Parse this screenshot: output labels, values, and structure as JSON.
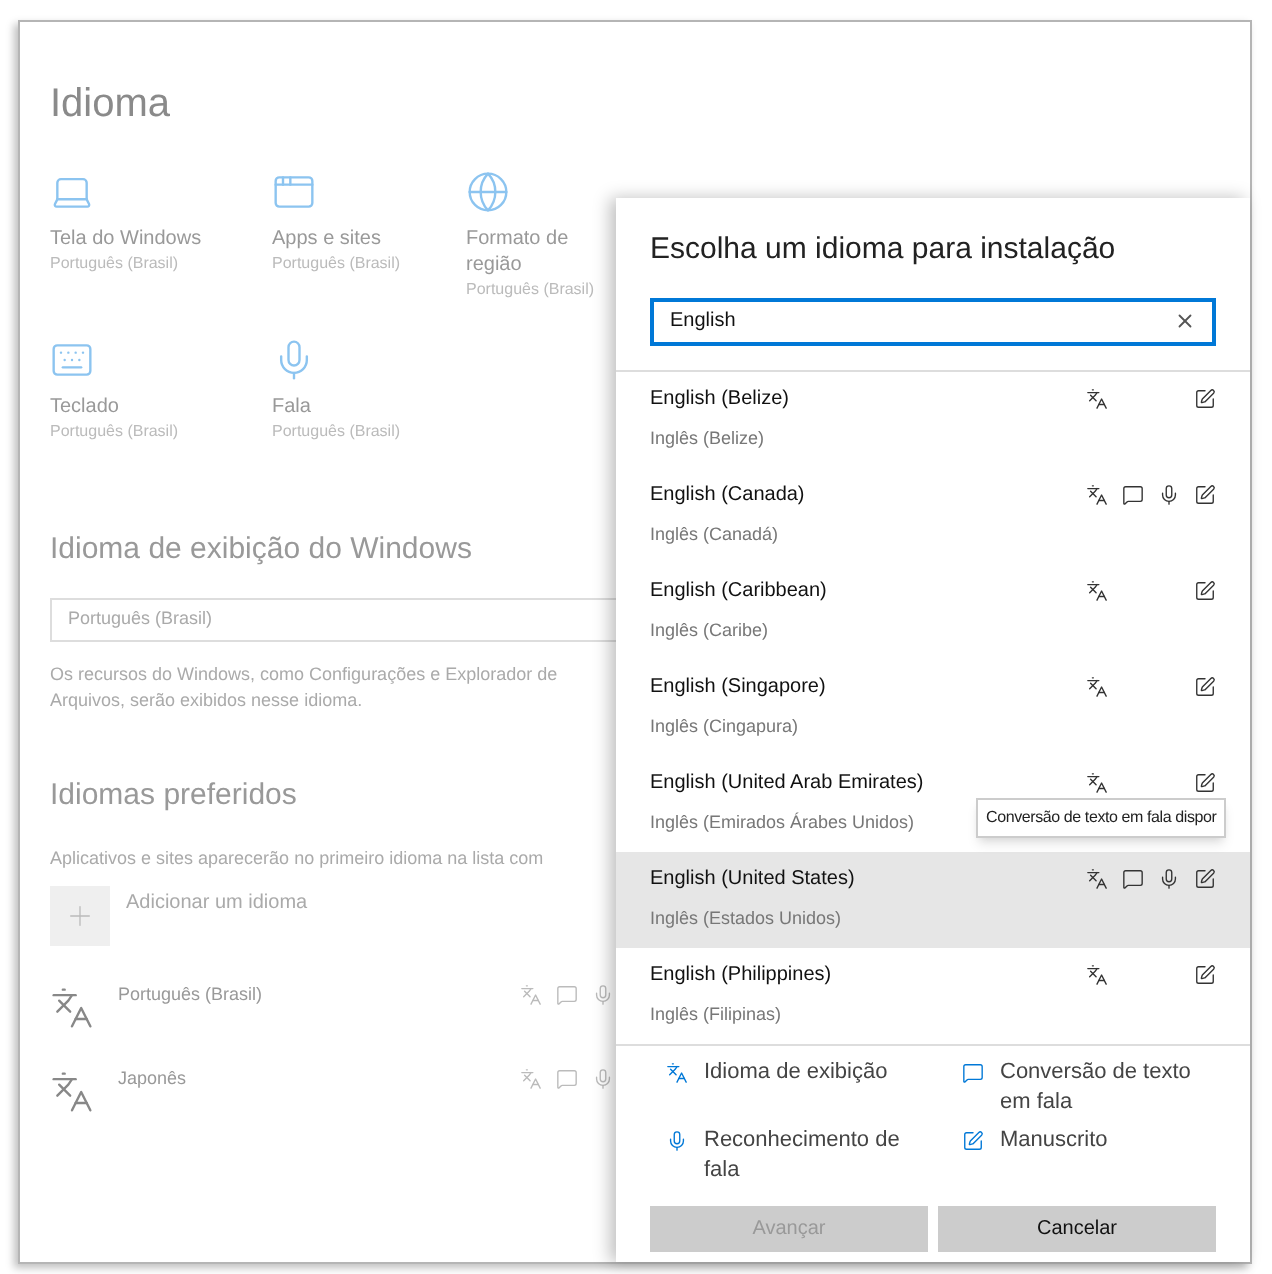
{
  "settings": {
    "title": "Idioma",
    "tiles": [
      {
        "kind": "laptop",
        "label": "Tela do Windows",
        "value": "Português (Brasil)"
      },
      {
        "kind": "window",
        "label": "Apps e sites",
        "value": "Português (Brasil)"
      },
      {
        "kind": "globe",
        "label": "Formato de região",
        "value": "Português (Brasil)"
      },
      {
        "kind": "keyboard",
        "label": "Teclado",
        "value": "Português (Brasil)"
      },
      {
        "kind": "microphone",
        "label": "Fala",
        "value": "Português (Brasil)"
      }
    ],
    "display_language": {
      "heading": "Idioma de exibição do Windows",
      "dropdown": "Português (Brasil)",
      "description": "Os recursos do Windows, como Configurações e Explorador de Arquivos, serão exibidos nesse idioma."
    },
    "preferred": {
      "heading": "Idiomas preferidos",
      "description": "Aplicativos e sites aparecerão no primeiro idioma na lista com",
      "add_label": "Adicionar um idioma",
      "languages": [
        {
          "name": "Português (Brasil)",
          "display": true,
          "tts": true,
          "speech": true
        },
        {
          "name": "Japonês",
          "display": true,
          "tts": true,
          "speech": true
        }
      ]
    }
  },
  "dialog": {
    "title": "Escolha um idioma para instalação",
    "search": {
      "value": "English"
    },
    "languages": [
      {
        "name": "English (Belize)",
        "native": "Inglês (Belize)",
        "display": true,
        "tts": false,
        "speech": false,
        "handwriting": true,
        "selected": false
      },
      {
        "name": "English (Canada)",
        "native": "Inglês (Canadá)",
        "display": true,
        "tts": true,
        "speech": true,
        "handwriting": true,
        "selected": false
      },
      {
        "name": "English (Caribbean)",
        "native": "Inglês (Caribe)",
        "display": true,
        "tts": false,
        "speech": false,
        "handwriting": true,
        "selected": false
      },
      {
        "name": "English (Singapore)",
        "native": "Inglês (Cingapura)",
        "display": true,
        "tts": false,
        "speech": false,
        "handwriting": true,
        "selected": false
      },
      {
        "name": "English (United Arab Emirates)",
        "native": "Inglês (Emirados Árabes Unidos)",
        "display": true,
        "tts": false,
        "speech": false,
        "handwriting": true,
        "selected": false
      },
      {
        "name": "English (United States)",
        "native": "Inglês (Estados Unidos)",
        "display": true,
        "tts": true,
        "speech": true,
        "handwriting": true,
        "selected": true
      },
      {
        "name": "English (Philippines)",
        "native": "Inglês (Filipinas)",
        "display": true,
        "tts": false,
        "speech": false,
        "handwriting": true,
        "selected": false
      }
    ],
    "tooltip": "Conversão de texto em fala dispor",
    "legend": [
      {
        "kind": "display",
        "label": "Idioma de exibição"
      },
      {
        "kind": "tts",
        "label": "Conversão de texto em fala"
      },
      {
        "kind": "speech",
        "label": "Reconhecimento de fala"
      },
      {
        "kind": "handwriting",
        "label": "Manuscrito"
      }
    ],
    "buttons": [
      {
        "label": "Avançar",
        "disabled": true
      },
      {
        "label": "Cancelar",
        "disabled": false
      }
    ]
  }
}
